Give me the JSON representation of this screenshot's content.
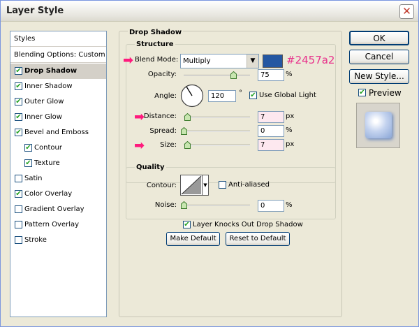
{
  "window": {
    "title": "Layer Style"
  },
  "styles_list": {
    "header": "Styles",
    "blending": "Blending Options: Custom",
    "items": [
      {
        "label": "Drop Shadow",
        "checked": true,
        "selected": true,
        "indent": false
      },
      {
        "label": "Inner Shadow",
        "checked": true,
        "selected": false,
        "indent": false
      },
      {
        "label": "Outer Glow",
        "checked": true,
        "selected": false,
        "indent": false
      },
      {
        "label": "Inner Glow",
        "checked": true,
        "selected": false,
        "indent": false
      },
      {
        "label": "Bevel and Emboss",
        "checked": true,
        "selected": false,
        "indent": false
      },
      {
        "label": "Contour",
        "checked": true,
        "selected": false,
        "indent": true
      },
      {
        "label": "Texture",
        "checked": true,
        "selected": false,
        "indent": true
      },
      {
        "label": "Satin",
        "checked": false,
        "selected": false,
        "indent": false
      },
      {
        "label": "Color Overlay",
        "checked": true,
        "selected": false,
        "indent": false
      },
      {
        "label": "Gradient Overlay",
        "checked": false,
        "selected": false,
        "indent": false
      },
      {
        "label": "Pattern Overlay",
        "checked": false,
        "selected": false,
        "indent": false
      },
      {
        "label": "Stroke",
        "checked": false,
        "selected": false,
        "indent": false
      }
    ]
  },
  "drop_shadow": {
    "title": "Drop Shadow",
    "structure": {
      "title": "Structure",
      "blend_mode_label": "Blend Mode:",
      "blend_mode_value": "Multiply",
      "color_swatch": "#2457a2",
      "color_annotation": "#2457a2",
      "opacity_label": "Opacity:",
      "opacity_value": "75",
      "opacity_unit": "%",
      "opacity_level": 0.75,
      "angle_label": "Angle:",
      "angle_value": "120",
      "angle_unit": "°",
      "use_global_light_label": "Use Global Light",
      "use_global_light_checked": true,
      "distance_label": "Distance:",
      "distance_value": "7",
      "distance_unit": "px",
      "spread_label": "Spread:",
      "spread_value": "0",
      "spread_unit": "%",
      "size_label": "Size:",
      "size_value": "7",
      "size_unit": "px"
    },
    "quality": {
      "title": "Quality",
      "contour_label": "Contour:",
      "anti_aliased_label": "Anti-aliased",
      "anti_aliased_checked": false,
      "noise_label": "Noise:",
      "noise_value": "0",
      "noise_unit": "%"
    },
    "knockout_label": "Layer Knocks Out Drop Shadow",
    "knockout_checked": true,
    "make_default_label": "Make Default",
    "reset_default_label": "Reset to Default"
  },
  "buttons": {
    "ok": "OK",
    "cancel": "Cancel",
    "new_style": "New Style...",
    "preview_label": "Preview",
    "preview_checked": true
  },
  "colors": {
    "annotation_arrow": "#ff1a7d",
    "selection": "#d4d0c8"
  }
}
